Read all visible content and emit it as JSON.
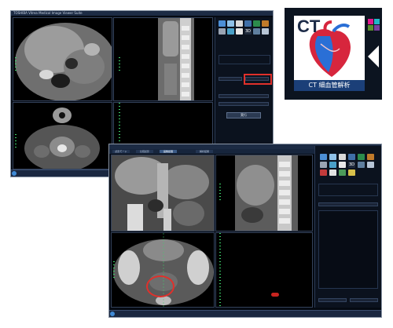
{
  "top_window": {
    "title": "TOSHIBA Vitrea Medical Image Viewer Suite",
    "execute_button": "実行",
    "highlight_color": "#e0302b"
  },
  "bottom_window": {
    "tabs": [
      "読影モード",
      "比較読影",
      "画像処理",
      "解析結果"
    ],
    "active_tab": 2,
    "annotation_color": "#e0302b"
  },
  "logo": {
    "ct_text": "CT",
    "caption": "CT 細血管解析",
    "swatches": [
      "#e2198c",
      "#22b7c8",
      "#5a8f2e",
      "#7b3fa0"
    ]
  },
  "toolbar_icons": [
    "layout-icon",
    "zoom-icon",
    "pan-icon",
    "window-level-icon",
    "rotate-icon",
    "measure-icon",
    "3d-icon",
    "settings-icon"
  ],
  "three_d_label": "3D"
}
